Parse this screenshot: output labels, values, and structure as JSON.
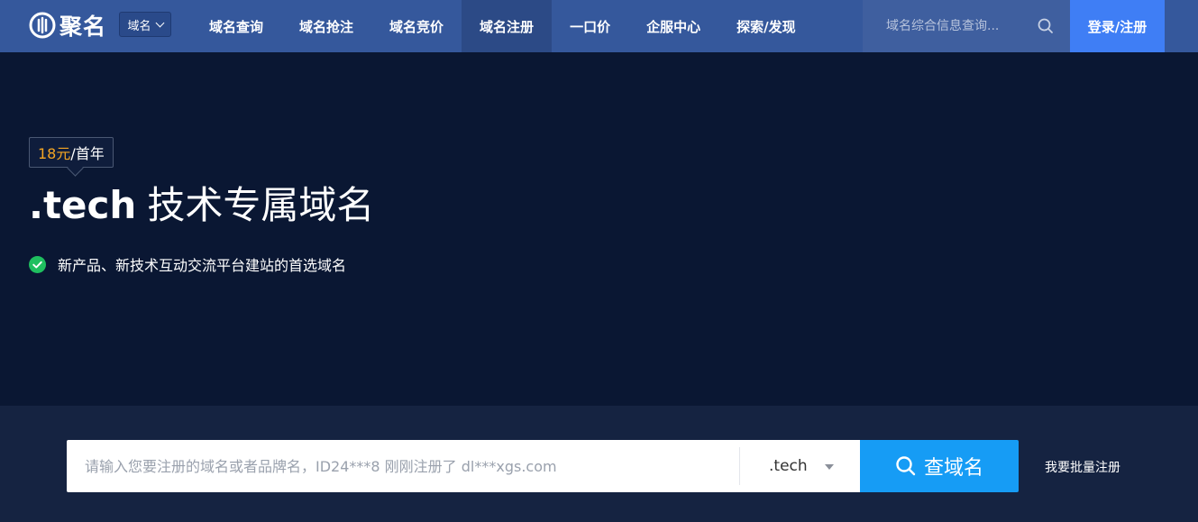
{
  "nav": {
    "logo_text": "聚名",
    "domain_select": "域名",
    "items": [
      {
        "label": "域名查询"
      },
      {
        "label": "域名抢注"
      },
      {
        "label": "域名竞价"
      },
      {
        "label": "域名注册"
      },
      {
        "label": "一口价"
      },
      {
        "label": "企服中心"
      },
      {
        "label": "探索/发现"
      }
    ],
    "search_placeholder": "域名综合信息查询...",
    "login_label": "登录/注册"
  },
  "hero": {
    "price": "18元",
    "price_unit": "/首年",
    "tld": ".tech",
    "title_desc": "技术专属域名",
    "feature": "新产品、新技术互动交流平台建站的首选域名"
  },
  "search": {
    "placeholder": "请输入您要注册的域名或者品牌名，ID24***8 刚刚注册了 dl***xgs.com",
    "tld_selected": ".tech",
    "button_label": "查域名",
    "bulk_link": "我要批量注册"
  },
  "colors": {
    "nav_bg": "#35589c",
    "accent_blue": "#169cf5",
    "login_blue": "#3f7ef5",
    "price_orange": "#f5a623",
    "check_green": "#1fbf5f"
  }
}
